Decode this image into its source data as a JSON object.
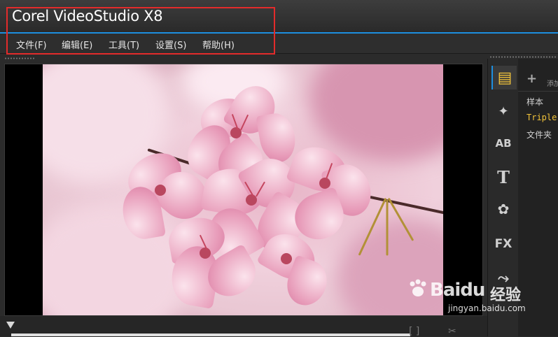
{
  "app": {
    "title": "Corel  VideoStudio X8"
  },
  "menu": {
    "items": [
      {
        "label": "文件(F)"
      },
      {
        "label": "编辑(E)"
      },
      {
        "label": "工具(T)"
      },
      {
        "label": "设置(S)"
      },
      {
        "label": "帮助(H)"
      }
    ]
  },
  "sidebar_tools": [
    {
      "icon": "media-icon",
      "glyph": "▤",
      "active": true
    },
    {
      "icon": "instant-project-icon",
      "glyph": "✦"
    },
    {
      "icon": "transition-icon",
      "glyph": "AB"
    },
    {
      "icon": "title-icon",
      "glyph": "T"
    },
    {
      "icon": "graphic-icon",
      "glyph": "✿"
    },
    {
      "icon": "filter-icon",
      "glyph": "FX"
    },
    {
      "icon": "path-icon",
      "glyph": "⤳"
    }
  ],
  "library": {
    "add_label": "添加",
    "items": [
      {
        "label": "样本"
      },
      {
        "label": "Triple",
        "selected": true
      },
      {
        "label": "文件夹"
      }
    ]
  },
  "preview_controls": {
    "bracket": "[ ]",
    "cut": "✂"
  },
  "watermark": {
    "brand": "Baidu",
    "cn": "经验",
    "sub": "jingyan.baidu.com"
  },
  "colors": {
    "accent": "#1d8fe0",
    "highlight_box": "#e32b2b",
    "selected_text": "#f3c43a"
  }
}
